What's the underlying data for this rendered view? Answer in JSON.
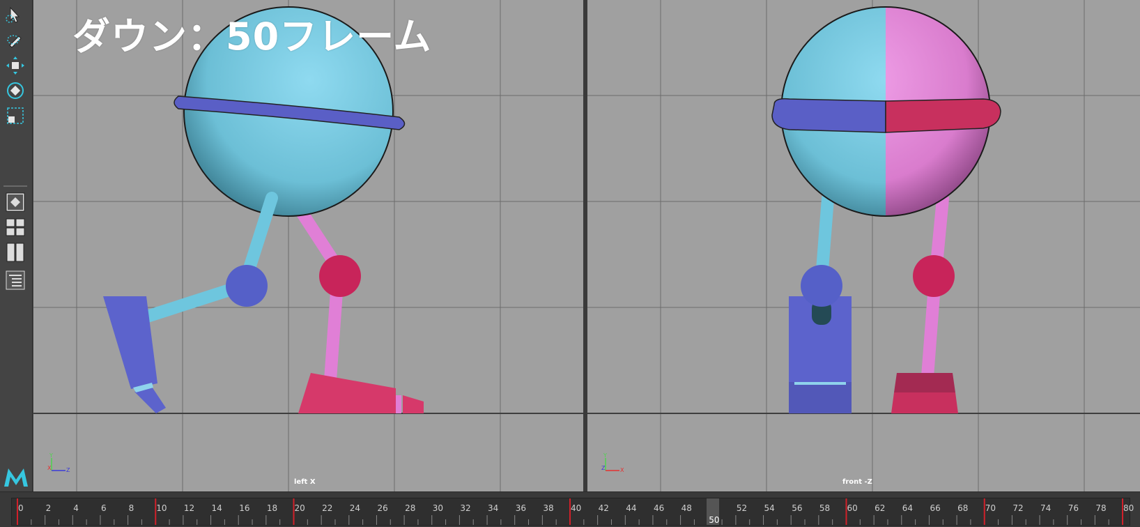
{
  "toolbox": {
    "tools": [
      {
        "name": "select-tool-icon"
      },
      {
        "name": "lasso-tool-icon"
      },
      {
        "name": "move-tool-icon"
      },
      {
        "name": "rotate-tool-icon"
      },
      {
        "name": "scale-tool-icon"
      }
    ],
    "layout_buttons": [
      {
        "name": "single-pane-layout-icon"
      },
      {
        "name": "four-pane-layout-icon"
      },
      {
        "name": "two-pane-layout-icon"
      },
      {
        "name": "outliner-layout-icon"
      }
    ],
    "accent": "#36c7e0"
  },
  "overlay_title": "ダウン：50フレーム",
  "viewports": {
    "left": {
      "camera_label": "left X",
      "axis_labels": {
        "up": "Y",
        "left": "X",
        "right": "Z"
      }
    },
    "right": {
      "camera_label": "front -Z",
      "axis_labels": {
        "up": "Y",
        "left": "Z",
        "right": "X"
      }
    }
  },
  "colors": {
    "viewport_bg": "#a0a0a0",
    "grid_line": "#6c6c6c",
    "body_cyan": "#7fcbe0",
    "body_pink": "#e88ad8",
    "ring_blue": "#5a5fc6",
    "ring_red": "#c8305e",
    "leg_cyan": "#6ec6de",
    "leg_pink": "#e07fd6",
    "joint_blue": "#5560c8",
    "joint_red": "#c8245a",
    "foot_blue": "#5c63cc",
    "foot_red": "#d6396a"
  },
  "timeline": {
    "range_start": 0,
    "range_end": 80,
    "labels": [
      0,
      2,
      4,
      6,
      8,
      10,
      12,
      14,
      16,
      18,
      20,
      22,
      24,
      26,
      28,
      30,
      32,
      34,
      36,
      38,
      40,
      42,
      44,
      46,
      48,
      50,
      52,
      54,
      56,
      58,
      60,
      62,
      64,
      66,
      68,
      70,
      72,
      74,
      76,
      78,
      80
    ],
    "keyframes": [
      0,
      10,
      20,
      40,
      50,
      60,
      70,
      80
    ],
    "current_frame": 50,
    "current_frame_text": "50"
  }
}
